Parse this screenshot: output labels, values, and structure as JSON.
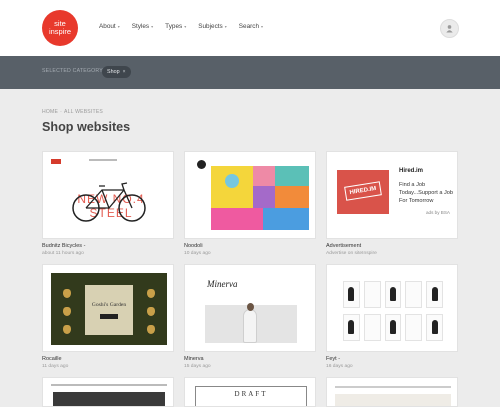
{
  "header": {
    "logo_line1": "site",
    "logo_line2": "inspire",
    "nav": [
      {
        "label": "About"
      },
      {
        "label": "Styles"
      },
      {
        "label": "Types"
      },
      {
        "label": "Subjects"
      },
      {
        "label": "Search"
      }
    ],
    "caret_glyph": "▾",
    "user_icon": "user-icon"
  },
  "category_bar": {
    "label": "SELECTED CATEGORY:",
    "pill_label": "Shop",
    "pill_close": "×"
  },
  "breadcrumb": {
    "home": "HOME",
    "separator": "·",
    "current": "ALL WEBSITES"
  },
  "page": {
    "title": "Shop websites"
  },
  "cards": [
    {
      "name": "Budnitz Bicycles -",
      "date": "about 11 hours ago"
    },
    {
      "name": "Noodoli",
      "date": "10 days ago"
    },
    {
      "name": "Advertisement",
      "date": "Advertise on siteInspire"
    },
    {
      "name": "Rocaille",
      "date": "11 days ago"
    },
    {
      "name": "Minerva",
      "date": "15 days ago"
    },
    {
      "name": "Feyt -",
      "date": "16 days ago"
    }
  ],
  "thumbs": {
    "budnitz_text": "NEW NO.4 STEEL",
    "ad": {
      "stamp": "HIRED.IM",
      "title": "Hired.im",
      "body": "Find a Job Today...Support a Job For Tomorrow",
      "ads_by": "ads by BSA"
    },
    "rocaille_title": "Goshi's Garden",
    "minerva_logo": "Minerva",
    "bottom_middle": "DRAFT"
  },
  "colors": {
    "brand_red": "#e8392c",
    "category_bar": "#586068",
    "background": "#ececec"
  }
}
